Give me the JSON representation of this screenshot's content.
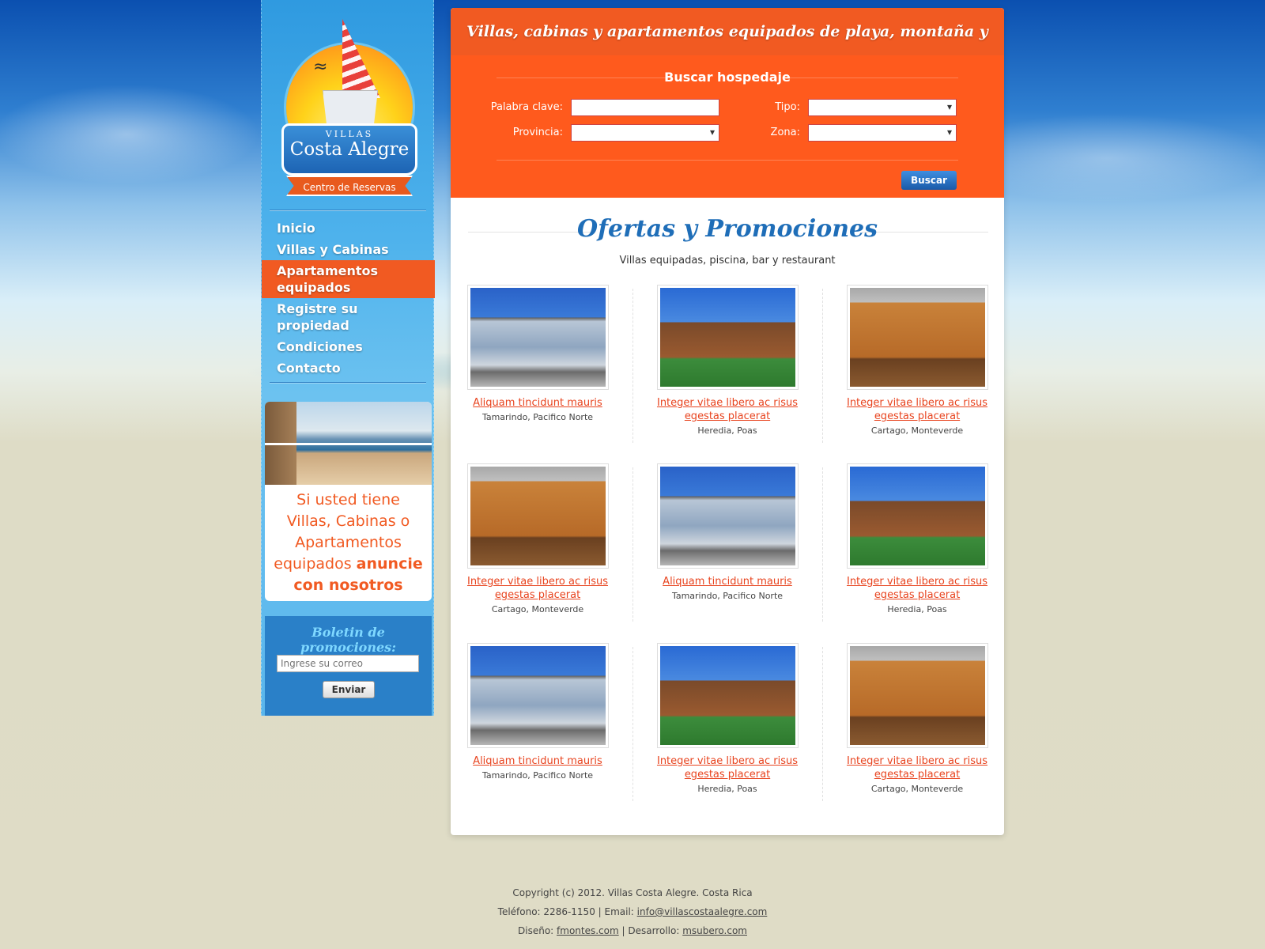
{
  "brand": {
    "top": "VILLAS",
    "name": "Costa Alegre",
    "ribbon": "Centro de Reservas"
  },
  "nav": [
    {
      "label": "Inicio"
    },
    {
      "label": "Villas y Cabinas"
    },
    {
      "label": "Apartamentos equipados"
    },
    {
      "label": "Registre su propiedad"
    },
    {
      "label": "Condiciones"
    },
    {
      "label": "Contacto"
    }
  ],
  "promo": {
    "text": "Si usted tiene Villas, Cabinas o Apartamentos equipados",
    "bold": "anuncie con nosotros"
  },
  "newsletter": {
    "title": "Boletin de promociones:",
    "placeholder": "Ingrese su correo",
    "button": "Enviar"
  },
  "banner": "Villas, cabinas y apartamentos equipados de playa, montaña y ciudad",
  "search": {
    "title": "Buscar hospedaje",
    "keyword_label": "Palabra clave:",
    "type_label": "Tipo:",
    "province_label": "Provincia:",
    "zone_label": "Zona:",
    "button": "Buscar"
  },
  "offers": {
    "title": "Ofertas y Promociones",
    "subtitle": "Villas equipadas, piscina, bar y restaurant",
    "items": [
      {
        "title": "Aliquam tincidunt mauris",
        "location": "Tamarindo, Pacifico Norte",
        "image": "modern-house"
      },
      {
        "title": "Integer vitae libero ac risus egestas placerat",
        "location": "Heredia, Poas",
        "image": "wood-house"
      },
      {
        "title": "Integer vitae libero ac risus egestas placerat",
        "location": "Cartago, Monteverde",
        "image": "log-cabin"
      },
      {
        "title": "Integer vitae libero ac risus egestas placerat",
        "location": "Cartago, Monteverde",
        "image": "log-cabin"
      },
      {
        "title": "Aliquam tincidunt mauris",
        "location": "Tamarindo, Pacifico Norte",
        "image": "modern-house"
      },
      {
        "title": "Integer vitae libero ac risus egestas placerat",
        "location": "Heredia, Poas",
        "image": "wood-house"
      },
      {
        "title": "Aliquam tincidunt mauris",
        "location": "Tamarindo, Pacifico Norte",
        "image": "modern-house"
      },
      {
        "title": "Integer vitae libero ac risus egestas placerat",
        "location": "Heredia, Poas",
        "image": "wood-house"
      },
      {
        "title": "Integer vitae libero ac risus egestas placerat",
        "location": "Cartago, Monteverde",
        "image": "log-cabin"
      }
    ]
  },
  "footer": {
    "copyright": "Copyright (c) 2012. Villas Costa Alegre. Costa Rica",
    "phone": "Teléfono: 2286-1150",
    "email_label": "Email:",
    "email": "info@villascostaalegre.com",
    "design_label": "Diseño:",
    "design": "fmontes.com",
    "dev_label": "Desarrollo:",
    "dev": "msubero.com"
  },
  "colors": {
    "accent": "#f15a22",
    "blue": "#1f6eb8"
  }
}
